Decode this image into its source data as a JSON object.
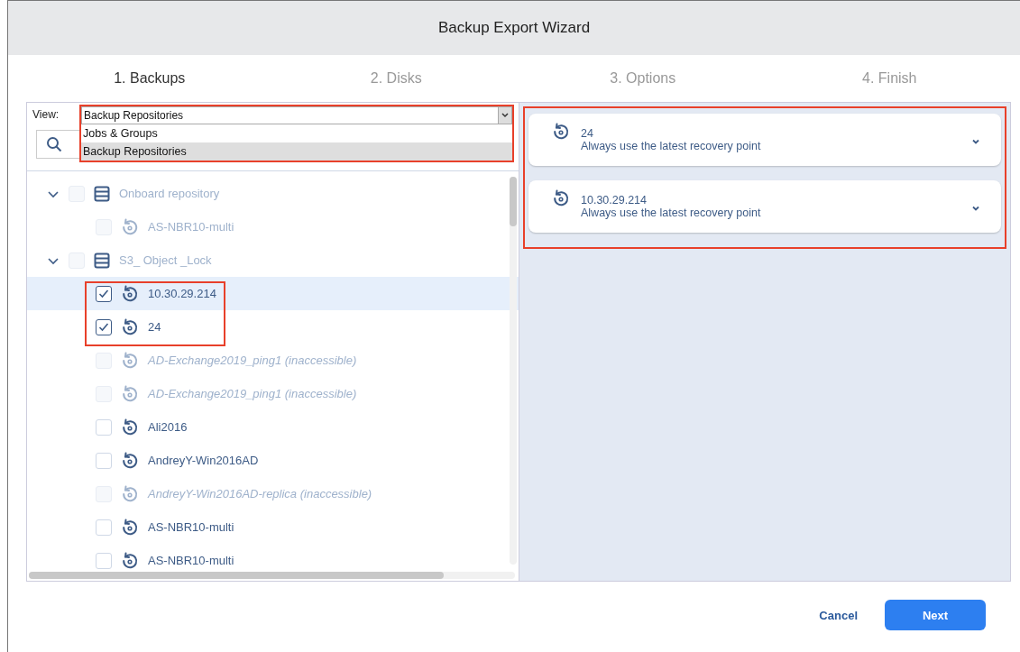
{
  "window": {
    "title": "Backup Export Wizard"
  },
  "steps": [
    {
      "label": "1. Backups",
      "selected": true
    },
    {
      "label": "2. Disks",
      "selected": false
    },
    {
      "label": "3. Options",
      "selected": false
    },
    {
      "label": "4. Finish",
      "selected": false
    }
  ],
  "view": {
    "label": "View:",
    "value": "Backup Repositories",
    "expanded": true,
    "options": [
      {
        "label": "Jobs & Groups",
        "selected": false
      },
      {
        "label": "Backup Repositories",
        "selected": true
      }
    ]
  },
  "tree": [
    {
      "kind": "repository",
      "label": "Onboard repository",
      "expanded": true,
      "checked": false,
      "disabled": true,
      "children": [
        {
          "kind": "backup",
          "label": "AS-NBR10-multi",
          "checked": false,
          "disabled": true,
          "inaccessible": false,
          "selected": false
        }
      ]
    },
    {
      "kind": "repository",
      "label": "S3_ Object _Lock",
      "expanded": true,
      "checked": false,
      "disabled": true,
      "children": [
        {
          "kind": "backup",
          "label": "10.30.29.214",
          "checked": true,
          "disabled": false,
          "inaccessible": false,
          "selected": true
        },
        {
          "kind": "backup",
          "label": "24",
          "checked": true,
          "disabled": false,
          "inaccessible": false,
          "selected": false
        },
        {
          "kind": "backup",
          "label": "AD-Exchange2019_ping1 (inaccessible)",
          "checked": false,
          "disabled": true,
          "inaccessible": true,
          "selected": false
        },
        {
          "kind": "backup",
          "label": "AD-Exchange2019_ping1 (inaccessible)",
          "checked": false,
          "disabled": true,
          "inaccessible": true,
          "selected": false
        },
        {
          "kind": "backup",
          "label": "Ali2016",
          "checked": false,
          "disabled": false,
          "inaccessible": false,
          "selected": false
        },
        {
          "kind": "backup",
          "label": "AndreyY-Win2016AD",
          "checked": false,
          "disabled": false,
          "inaccessible": false,
          "selected": false
        },
        {
          "kind": "backup",
          "label": "AndreyY-Win2016AD-replica (inaccessible)",
          "checked": false,
          "disabled": true,
          "inaccessible": true,
          "selected": false
        },
        {
          "kind": "backup",
          "label": "AS-NBR10-multi",
          "checked": false,
          "disabled": false,
          "inaccessible": false,
          "selected": false
        },
        {
          "kind": "backup",
          "label": "AS-NBR10-multi",
          "checked": false,
          "disabled": false,
          "inaccessible": false,
          "selected": false
        }
      ]
    }
  ],
  "selected_backups": [
    {
      "name": "24",
      "recovery_point": "Always use the latest recovery point"
    },
    {
      "name": "10.30.29.214",
      "recovery_point": "Always use the latest recovery point"
    }
  ],
  "buttons": {
    "cancel": "Cancel",
    "next": "Next"
  }
}
